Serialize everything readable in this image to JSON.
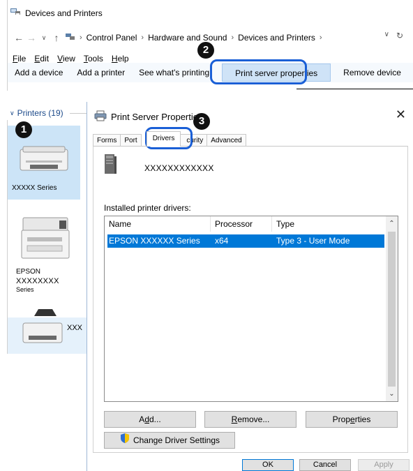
{
  "explorer": {
    "title": "Devices and Printers",
    "breadcrumb": [
      "Control Panel",
      "Hardware and Sound",
      "Devices and Printers"
    ],
    "menu": [
      {
        "pre": "",
        "key": "F",
        "post": "ile"
      },
      {
        "pre": "",
        "key": "E",
        "post": "dit"
      },
      {
        "pre": "",
        "key": "V",
        "post": "iew"
      },
      {
        "pre": "",
        "key": "T",
        "post": "ools"
      },
      {
        "pre": "",
        "key": "H",
        "post": "elp"
      }
    ],
    "commands": [
      "Add a device",
      "Add a printer",
      "See what's printing",
      "Print server properties",
      "Remove device"
    ]
  },
  "printers_pane": {
    "header": "Printers (19)",
    "items": [
      {
        "label": "XXXXX Series"
      },
      {
        "label_line1": "EPSON",
        "label_line2": "XXXXXXXX",
        "label_line3": "Series"
      },
      {
        "label": "XXX"
      }
    ]
  },
  "dialog": {
    "title": "Print Server Properties",
    "tabs": [
      "Forms",
      "Port",
      "Drivers",
      "curity",
      "Advanced"
    ],
    "server_name": "XXXXXXXXXXXX",
    "installed_label": "Installed printer drivers:",
    "columns": [
      "Name",
      "Processor",
      "Type"
    ],
    "rows": [
      {
        "name": "EPSON XXXXXX Series",
        "processor": "x64",
        "type": "Type 3 - User Mode"
      }
    ],
    "buttons": {
      "add_pre": "A",
      "add_key": "d",
      "add_post": "d...",
      "remove_key": "R",
      "remove_post": "emove...",
      "props_pre": "Prop",
      "props_key": "e",
      "props_post": "rties",
      "change_driver": "Change Driver Settings",
      "ok": "OK",
      "cancel": "Cancel",
      "apply": "Apply"
    }
  },
  "callouts": [
    "1",
    "2",
    "3"
  ],
  "colors": {
    "callout": "#1a5fd6",
    "selection": "#0078d7",
    "command_bar": "#f5f9fd"
  }
}
